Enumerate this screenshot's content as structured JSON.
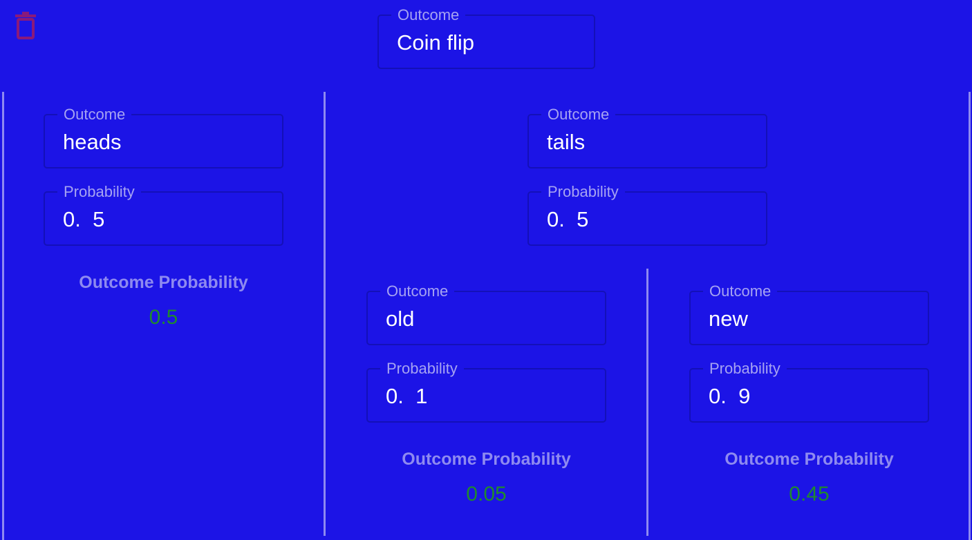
{
  "root": {
    "outcome_label": "Outcome",
    "outcome_value": "Coin flip"
  },
  "branches": {
    "heads": {
      "outcome_label": "Outcome",
      "outcome_value": "heads",
      "probability_label": "Probability",
      "probability_value": "0.  5",
      "result_label": "Outcome Probability",
      "result_value": "0.5"
    },
    "tails": {
      "outcome_label": "Outcome",
      "outcome_value": "tails",
      "probability_label": "Probability",
      "probability_value": "0.  5"
    },
    "old": {
      "outcome_label": "Outcome",
      "outcome_value": "old",
      "probability_label": "Probability",
      "probability_value": "0.  1",
      "result_label": "Outcome Probability",
      "result_value": "0.05"
    },
    "new": {
      "outcome_label": "Outcome",
      "outcome_value": "new",
      "probability_label": "Probability",
      "probability_value": "0.  9",
      "result_label": "Outcome Probability",
      "result_value": "0.45"
    }
  },
  "icons": {
    "delete": "trash-icon"
  },
  "colors": {
    "background": "#1c14e6",
    "field_border": "#1410b8",
    "label": "#a6a3f2",
    "divider": "#8e8af0",
    "result": "#1f8a2e",
    "delete_icon": "#8a1a7a"
  }
}
